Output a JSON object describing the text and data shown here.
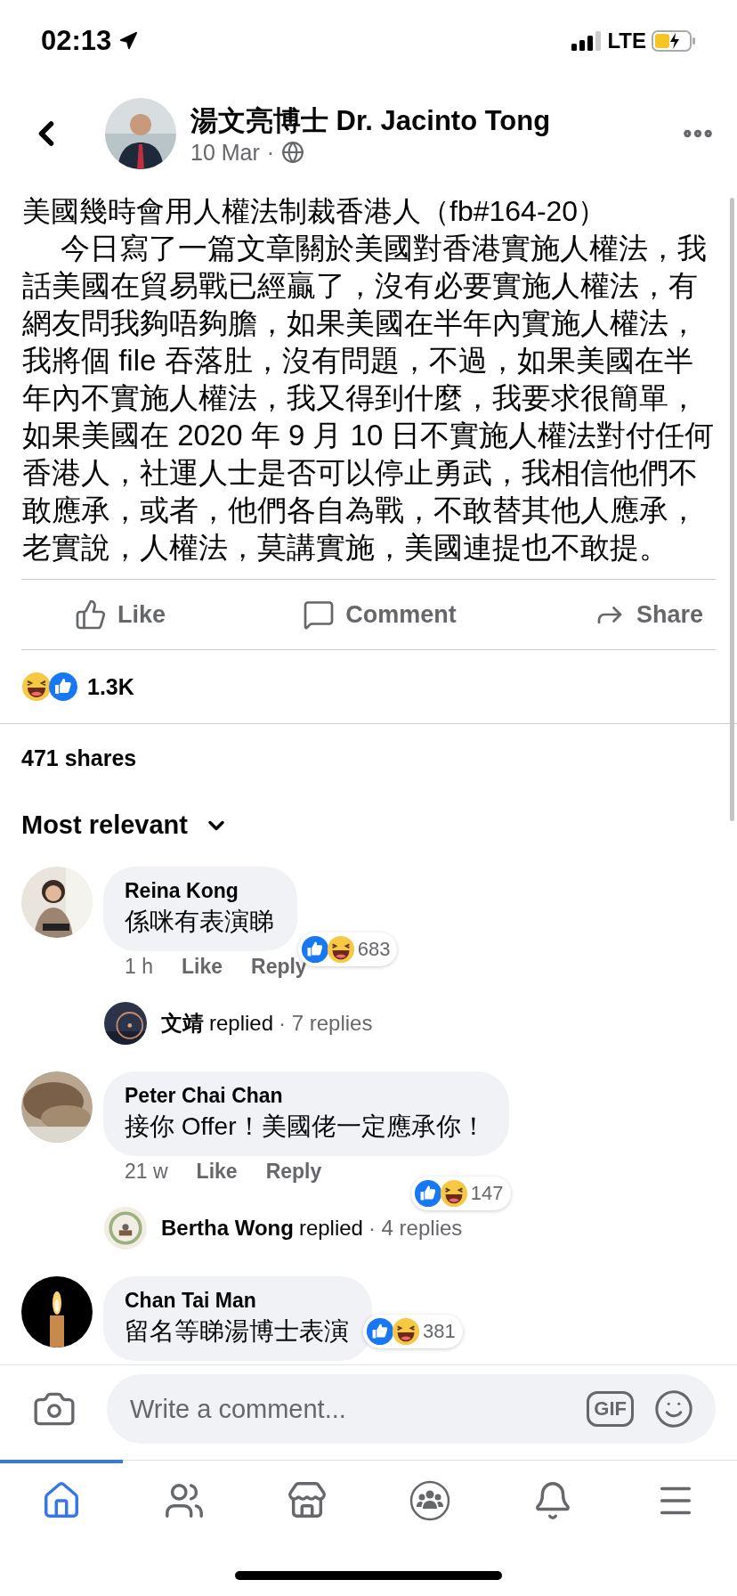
{
  "status_bar": {
    "time": "02:13",
    "network": "LTE"
  },
  "post": {
    "author": "湯文亮博士 Dr. Jacinto Tong",
    "date": "10 Mar",
    "separator": "·",
    "title": "美國幾時會用人權法制裁香港人（fb#164-20）",
    "body": "今日寫了一篇文章關於美國對香港實施人權法，我話美國在貿易戰已經贏了，沒有必要實施人權法，有網友問我夠唔夠膽，如果美國在半年內實施人權法，我將個 file 吞落肚，沒有問題，不過，如果美國在半年內不實施人權法，我又得到什麼，我要求很簡單，如果美國在 2020 年 9 月 10 日不實施人權法對付任何香港人，社運人士是否可以停止勇武，我相信他們不敢應承，或者，他們各自為戰，不敢替其他人應承，老實說，人權法，莫講實施，美國連提也不敢提。"
  },
  "actions": [
    {
      "kind": "like",
      "label": "Like"
    },
    {
      "kind": "comment",
      "label": "Comment"
    },
    {
      "kind": "share",
      "label": "Share"
    }
  ],
  "reactions": {
    "count": "1.3K"
  },
  "shares": "471 shares",
  "sort": {
    "label": "Most relevant"
  },
  "comments": [
    {
      "author": "Reina Kong",
      "text": "係咪有表演睇",
      "reaction_count": "683",
      "badge_overlaps": false,
      "time": "1 h",
      "like": "Like",
      "reply": "Reply",
      "thread": {
        "name": "文靖",
        "verb": "replied",
        "count": "· 7 replies"
      }
    },
    {
      "author": "Peter Chai Chan",
      "text": "接你 Offer！美國佬一定應承你！",
      "reaction_count": "147",
      "badge_overlaps": true,
      "time": "21 w",
      "like": "Like",
      "reply": "Reply",
      "thread": {
        "name": "Bertha Wong",
        "verb": "replied",
        "count": "· 4 replies"
      }
    },
    {
      "author": "Chan Tai Man",
      "text": "留名等睇湯博士表演",
      "reaction_count": "381",
      "badge_overlaps": false
    }
  ],
  "composer": {
    "placeholder": "Write a comment...",
    "gif": "GIF"
  },
  "tabs": [
    {
      "kind": "home",
      "selected": true
    },
    {
      "kind": "friends",
      "selected": false
    },
    {
      "kind": "marketplace",
      "selected": false
    },
    {
      "kind": "groups",
      "selected": false
    },
    {
      "kind": "notifications",
      "selected": false
    },
    {
      "kind": "menu",
      "selected": false
    }
  ]
}
